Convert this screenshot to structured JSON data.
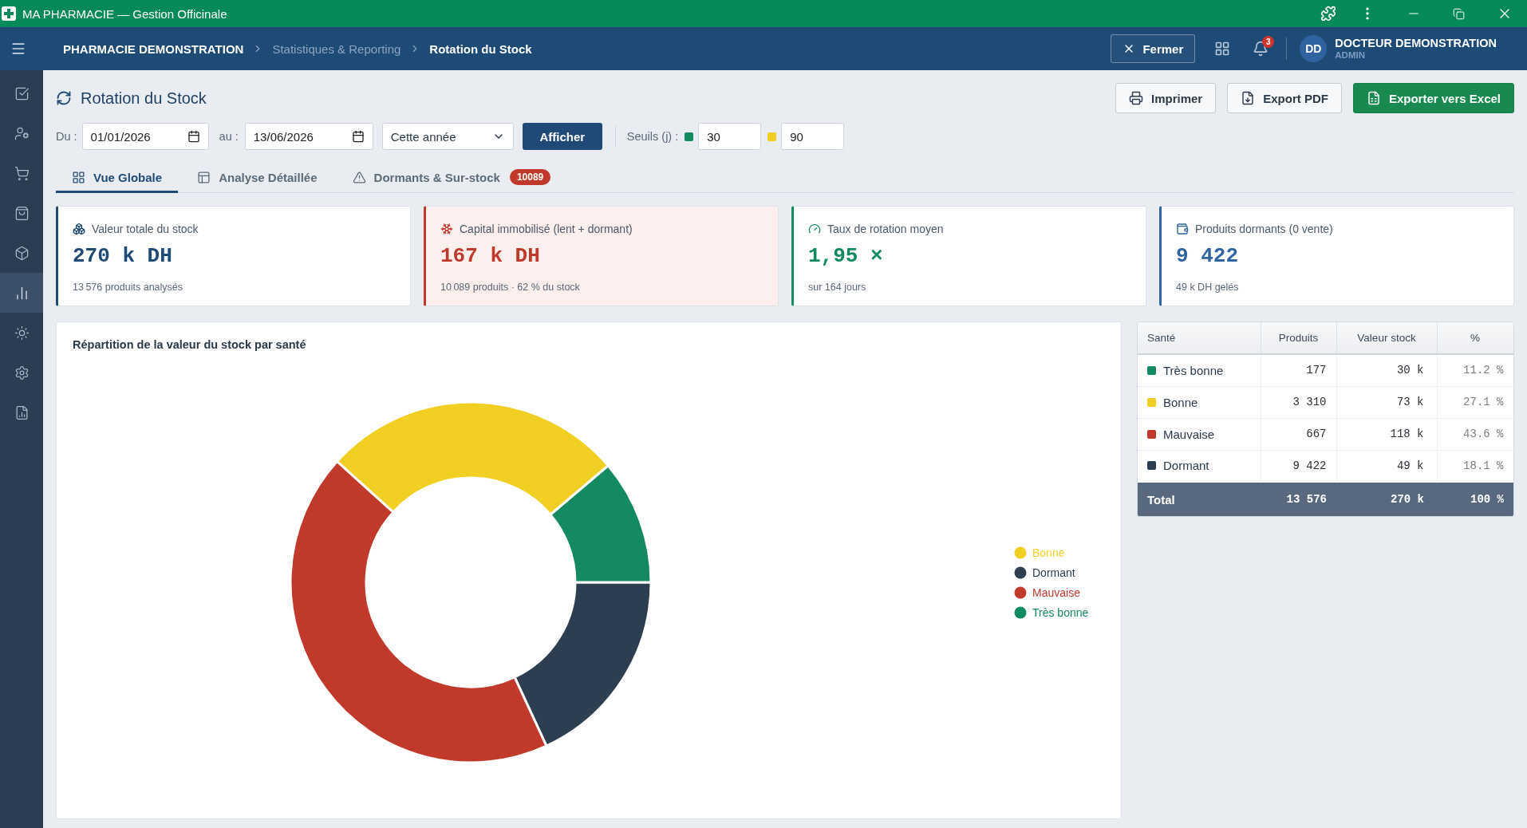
{
  "window": {
    "title": "MA PHARMACIE — Gestion Officinale"
  },
  "navbar": {
    "breadcrumb": [
      {
        "label": "PHARMACIE DEMONSTRATION",
        "kind": "root"
      },
      {
        "label": "Statistiques & Reporting",
        "kind": "link"
      },
      {
        "label": "Rotation du Stock",
        "kind": "current"
      }
    ],
    "close_button": "Fermer",
    "notification_count": "3",
    "user": {
      "initials": "DD",
      "name": "DOCTEUR DEMONSTRATION",
      "role": "ADMIN"
    }
  },
  "sidebar": {
    "items": [
      {
        "kind": "tasks",
        "selected": false
      },
      {
        "kind": "users",
        "selected": false
      },
      {
        "kind": "cart",
        "selected": false
      },
      {
        "kind": "orders",
        "selected": false
      },
      {
        "kind": "products",
        "selected": false
      },
      {
        "kind": "stats",
        "selected": true
      },
      {
        "kind": "light",
        "selected": false
      },
      {
        "kind": "settings",
        "selected": false
      },
      {
        "kind": "reports",
        "selected": false
      }
    ]
  },
  "page": {
    "title": "Rotation du Stock",
    "actions": [
      {
        "label": "Imprimer",
        "kind": "print"
      },
      {
        "label": "Export PDF",
        "kind": "pdf"
      },
      {
        "label": "Exporter vers Excel",
        "kind": "excel"
      }
    ]
  },
  "filters": {
    "from_label": "Du :",
    "from": "01/01/2026",
    "to_label": "au :",
    "to": "13/06/2026",
    "period": "Cette année",
    "submit": "Afficher",
    "thresholds_label": "Seuils (j) :",
    "thresholds": [
      {
        "color": "#138a5f",
        "value": "30"
      },
      {
        "color": "#f1cf22",
        "value": "90"
      }
    ]
  },
  "tabs": [
    {
      "label": "Vue Globale",
      "kind": "overview",
      "selected": true
    },
    {
      "label": "Analyse Détaillée",
      "kind": "detail",
      "selected": false
    },
    {
      "label": "Dormants & Sur-stock",
      "kind": "alerts",
      "selected": false,
      "badge": "10089"
    }
  ],
  "kpis": [
    {
      "kind": "stock",
      "label": "Valeur totale du stock",
      "value": "270 k DH",
      "note": "13 576 produits analysés"
    },
    {
      "kind": "capital",
      "label": "Capital immobilisé (lent + dormant)",
      "value": "167 k DH",
      "note": "10 089 produits · 62 % du stock"
    },
    {
      "kind": "rotation",
      "label": "Taux de rotation moyen",
      "value": "1,95 ×",
      "note": "sur 164 jours"
    },
    {
      "kind": "dormant",
      "label": "Produits dormants (0 vente)",
      "value": "9 422",
      "note": "49 k DH gelés"
    }
  ],
  "chart": {
    "chart_data": {
      "type": "donut",
      "title": "Répartition de la valeur du stock par santé",
      "categories": [
        "Bonne",
        "Dormant",
        "Mauvaise",
        "Très bonne"
      ],
      "values": [
        27.1,
        18.1,
        43.6,
        11.2
      ],
      "legend": "right"
    },
    "swatches": [
      {
        "color": "#f1cf22"
      },
      {
        "color": "#2c3e50"
      },
      {
        "color": "#c0392b"
      },
      {
        "color": "#138a5f"
      }
    ]
  },
  "health_table": {
    "columns": [
      "Santé",
      "Produits",
      "Valeur stock",
      "%"
    ],
    "rows": [
      {
        "label": "Très bonne",
        "color": "#138a5f",
        "products": "177",
        "value": "30 k",
        "percent": "11.2 %"
      },
      {
        "label": "Bonne",
        "color": "#f1cf22",
        "products": "3 310",
        "value": "73 k",
        "percent": "27.1 %"
      },
      {
        "label": "Mauvaise",
        "color": "#c0392b",
        "products": "667",
        "value": "118 k",
        "percent": "43.6 %"
      },
      {
        "label": "Dormant",
        "color": "#2c3e50",
        "products": "9 422",
        "value": "49 k",
        "percent": "18.1 %"
      }
    ],
    "total": {
      "label": "Total",
      "products": "13 576",
      "value": "270 k",
      "percent": "100 %"
    }
  }
}
